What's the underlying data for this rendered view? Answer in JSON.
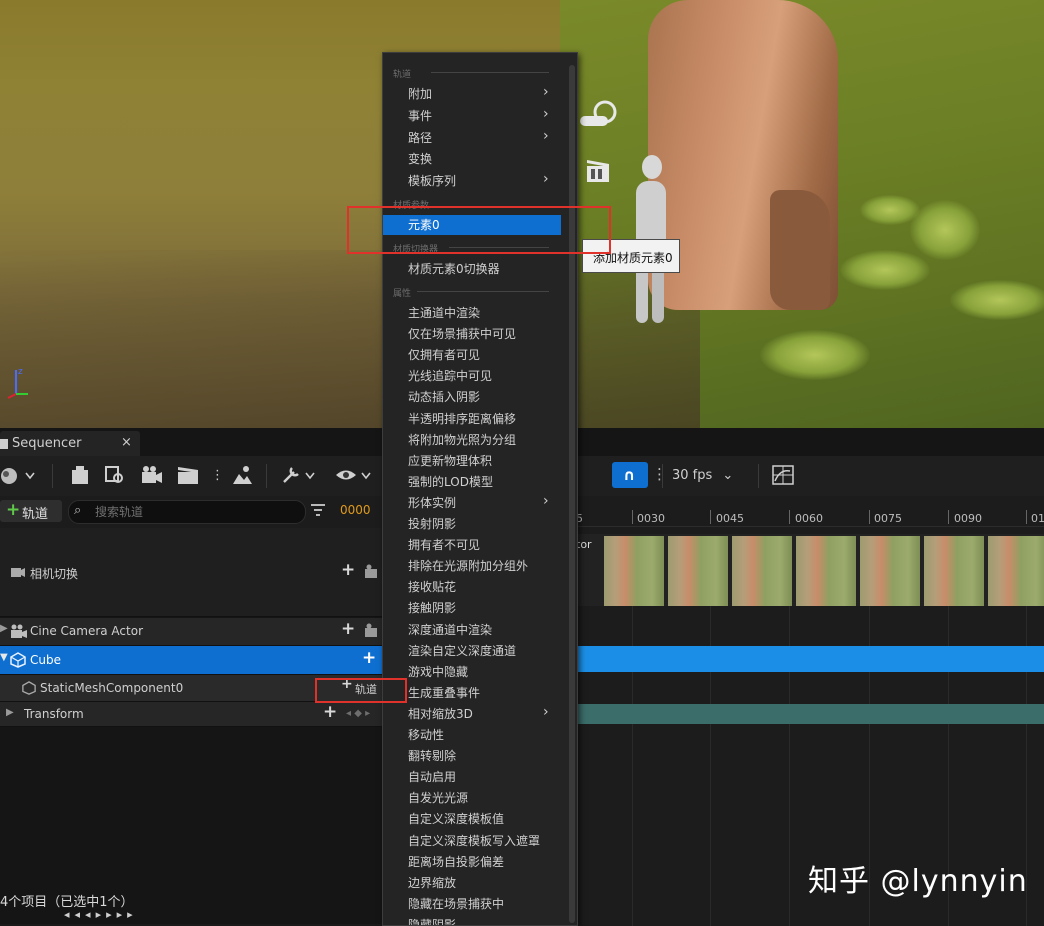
{
  "sequencer": {
    "tab_title": "Sequencer",
    "tab_close": "×",
    "add_track_label": "轨道",
    "search_placeholder": "搜索轨道",
    "frame": "0000",
    "fps": "30 fps",
    "status": "4个项目（已选中1个）"
  },
  "tracks": [
    {
      "label": "相机切换",
      "type": "camera-cut"
    },
    {
      "label": "Cine Camera Actor",
      "type": "actor"
    },
    {
      "label": "Cube",
      "type": "actor",
      "selected": true
    },
    {
      "label": "StaticMeshComponent0",
      "type": "component",
      "add_label": "轨道"
    },
    {
      "label": "Transform",
      "type": "property"
    }
  ],
  "timeline": {
    "ticks": [
      "5",
      "0030",
      "0045",
      "0060",
      "0075",
      "0090",
      "01"
    ],
    "camera_strip_partial_label": "tor"
  },
  "menu": {
    "sections": {
      "track": "轨道",
      "material_params": "材质参数",
      "material_switcher": "材质切换器",
      "properties": "属性"
    },
    "track_items": [
      {
        "label": "附加",
        "submenu": true
      },
      {
        "label": "事件",
        "submenu": true
      },
      {
        "label": "路径",
        "submenu": true
      },
      {
        "label": "变换",
        "submenu": false
      },
      {
        "label": "模板序列",
        "submenu": true
      }
    ],
    "material_item": "元素0",
    "switcher_item": "材质元素0切换器",
    "property_items": [
      {
        "label": "主通道中渲染",
        "submenu": false
      },
      {
        "label": "仅在场景捕获中可见",
        "submenu": false
      },
      {
        "label": "仅拥有者可见",
        "submenu": false
      },
      {
        "label": "光线追踪中可见",
        "submenu": false
      },
      {
        "label": "动态插入阴影",
        "submenu": false
      },
      {
        "label": "半透明排序距离偏移",
        "submenu": false
      },
      {
        "label": "将附加物光照为分组",
        "submenu": false
      },
      {
        "label": "应更新物理体积",
        "submenu": false
      },
      {
        "label": "强制的LOD模型",
        "submenu": false
      },
      {
        "label": "形体实例",
        "submenu": true
      },
      {
        "label": "投射阴影",
        "submenu": false
      },
      {
        "label": "拥有者不可见",
        "submenu": false
      },
      {
        "label": "排除在光源附加分组外",
        "submenu": false
      },
      {
        "label": "接收贴花",
        "submenu": false
      },
      {
        "label": "接触阴影",
        "submenu": false
      },
      {
        "label": "深度通道中渲染",
        "submenu": false
      },
      {
        "label": "渲染自定义深度通道",
        "submenu": false
      },
      {
        "label": "游戏中隐藏",
        "submenu": false
      },
      {
        "label": "生成重叠事件",
        "submenu": false
      },
      {
        "label": "相对缩放3D",
        "submenu": true
      },
      {
        "label": "移动性",
        "submenu": false
      },
      {
        "label": "翻转剔除",
        "submenu": false
      },
      {
        "label": "自动启用",
        "submenu": false
      },
      {
        "label": "自发光光源",
        "submenu": false
      },
      {
        "label": "自定义深度模板值",
        "submenu": false
      },
      {
        "label": "自定义深度模板写入遮罩",
        "submenu": false
      },
      {
        "label": "距离场自投影偏差",
        "submenu": false
      },
      {
        "label": "边界缩放",
        "submenu": false
      },
      {
        "label": "隐藏在场景捕获中",
        "submenu": false
      },
      {
        "label": "隐藏阴影",
        "submenu": false
      }
    ]
  },
  "tooltip": "添加材质元素0",
  "watermark": "知乎 @lynnyin",
  "colors": {
    "accent": "#0f6fd0",
    "selection": "#1b8fe8",
    "annotation": "#e0322b",
    "frame_value": "#e09a1a"
  }
}
